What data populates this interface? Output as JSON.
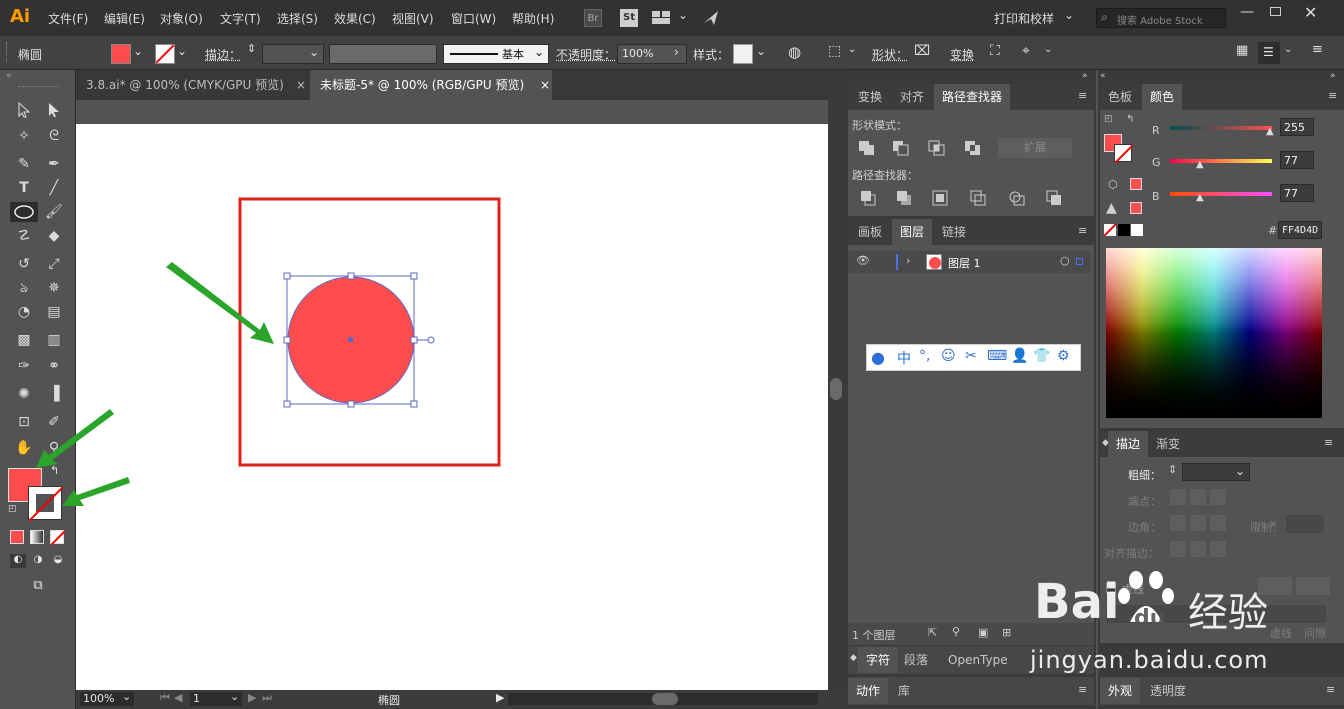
{
  "app": {
    "logo": "Ai"
  },
  "menu": [
    "文件(F)",
    "编辑(E)",
    "对象(O)",
    "文字(T)",
    "选择(S)",
    "效果(C)",
    "视图(V)",
    "窗口(W)",
    "帮助(H)"
  ],
  "menu_extras": {
    "br": "Br",
    "st": "St"
  },
  "workspace": "打印和校样",
  "search_placeholder": "搜索 Adobe Stock",
  "control": {
    "object_label": "椭圆",
    "stroke_label": "描边：",
    "brush_label": "基本",
    "opacity_label": "不透明度：",
    "opacity_value": "100%",
    "style_label": "样式：",
    "shape_label": "形状：",
    "transform_label": "变换"
  },
  "tabs": [
    {
      "label": "3.8.ai* @ 100% (CMYK/GPU 预览)",
      "close": "×"
    },
    {
      "label": "未标题-5* @ 100% (RGB/GPU 预览)",
      "close": "×"
    }
  ],
  "status": {
    "zoom": "100%",
    "page": "1",
    "tool": "椭圆"
  },
  "pathfinder": {
    "tabs": [
      "变换",
      "对齐",
      "路径查找器"
    ],
    "shape_modes": "形状模式：",
    "expand": "扩展",
    "pathfinders": "路径查找器："
  },
  "layers": {
    "tabs": [
      "画板",
      "图层",
      "链接"
    ],
    "layer_name": "图层 1",
    "count": "1 个图层"
  },
  "char_tabs": [
    "字符",
    "段落",
    "OpenType"
  ],
  "action_tabs": [
    "动作",
    "库"
  ],
  "color": {
    "tabs": [
      "色板",
      "颜色"
    ],
    "r_label": "R",
    "g_label": "G",
    "b_label": "B",
    "r": "255",
    "g": "77",
    "b": "77",
    "hex_prefix": "#",
    "hex": "FF4D4D",
    "fill_hex": "#FF4D4D"
  },
  "stroke": {
    "tabs": [
      "描边",
      "渐变"
    ],
    "weight": "粗细：",
    "cap": "端点：",
    "corner": "边角：",
    "limit": "限制：",
    "align": "对齐描边：",
    "dashed": "虚线",
    "dash_tail": "虚线",
    "gap_tail": "间隙"
  },
  "appearance_tabs": [
    "外观",
    "透明度"
  ],
  "ime": {
    "zh": "中"
  },
  "watermark": {
    "brand": "Bai",
    "du": "du",
    "jingyan": "经验",
    "url": "jingyan.baidu.com"
  }
}
